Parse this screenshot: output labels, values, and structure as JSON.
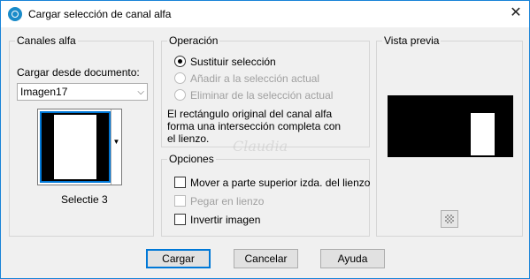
{
  "window": {
    "title": "Cargar selección de canal alfa",
    "close_glyph": "✕"
  },
  "alpha": {
    "legend": "Canales alfa",
    "load_label": "Cargar desde documento:",
    "document": "Imagen17",
    "caret": "⌵",
    "drop_glyph": "▼",
    "channel_name": "Selectie 3"
  },
  "operation": {
    "legend": "Operación",
    "options": [
      {
        "label": "Sustituir selección",
        "selected": true,
        "enabled": true
      },
      {
        "label": "Añadir a la selección actual",
        "selected": false,
        "enabled": false
      },
      {
        "label": "Eliminar de la selección actual",
        "selected": false,
        "enabled": false
      }
    ],
    "description_lines": [
      "El rectángulo original del canal alfa",
      "forma una intersección completa con",
      "el lienzo."
    ]
  },
  "options": {
    "legend": "Opciones",
    "items": [
      {
        "label": "Mover a parte superior izda. del lienzo",
        "checked": false,
        "enabled": true
      },
      {
        "label": "Pegar en lienzo",
        "checked": false,
        "enabled": false
      },
      {
        "label": "Invertir imagen",
        "checked": false,
        "enabled": true
      }
    ]
  },
  "preview": {
    "legend": "Vista previa"
  },
  "buttons": {
    "load": "Cargar",
    "cancel": "Cancelar",
    "help": "Ayuda"
  },
  "watermark": "Claudia",
  "colors": {
    "accent": "#0078d7",
    "border": "#1883d7"
  }
}
